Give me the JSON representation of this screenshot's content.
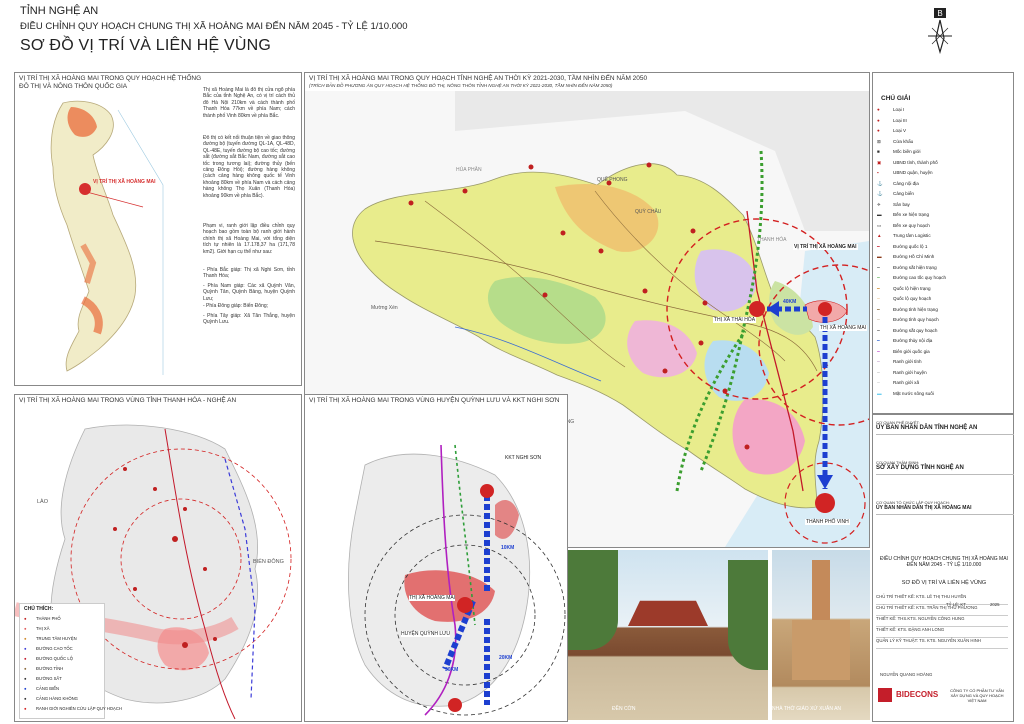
{
  "header": {
    "province": "TỈNH NGHỆ AN",
    "project": "ĐIỀU CHỈNH QUY HOẠCH CHUNG THỊ XÃ HOÀNG MAI ĐẾN NĂM 2045 - TỶ LỆ 1/10.000",
    "sheet_title": "SƠ ĐỒ VỊ TRÍ VÀ LIÊN HỆ VÙNG"
  },
  "panel_national": {
    "title1": "VỊ TRÍ THỊ XÃ HOÀNG MAI TRONG QUY HOẠCH HỆ THỐNG",
    "title2": "ĐÔ THỊ VÀ NÔNG THÔN QUỐC GIA",
    "map_label": "VỊ TRÍ THỊ XÃ HOÀNG MAI",
    "text1": "Thị xã Hoàng Mai là đô thị cửa ngõ phía Bắc của tỉnh Nghệ An, có vị trí cách thủ đô Hà Nội 210km và cách thành phố Thanh Hóa 77km về phía Nam; cách thành phố Vinh 80km về phía Bắc.",
    "text2": "Đô thị có kết nối thuận tiện về giao thông đường bộ (tuyến đường QL-1A, QL-48D, QL-48E, tuyến đường bộ cao tốc; đường sắt (đường sắt Bắc Nam, đường sắt cao tốc trong tương lai); đường thủy (bến cảng Đông Hồi); đường hàng không (cách cảng hàng không quốc tế Vinh khoảng 80km về phía Nam và cách cảng hàng không Thọ Xuân (Thanh Hóa) khoảng 90km về phía Bắc).",
    "text3": "Phạm vi, ranh giới lập điều chỉnh quy hoạch bao gồm toàn bộ ranh giới hành chính thị xã Hoàng Mai, với tổng diện tích tự nhiên là 17.178,37 ha (171,78 km2). Giới hạn cụ thể như sau:",
    "bounds": [
      "- Phía Bắc giáp: Thị xã Nghi Sơn, tỉnh Thanh Hóa;",
      "- Phía Nam giáp: Các xã Quỳnh Văn, Quỳnh Tân, Quỳnh Bảng, huyện Quỳnh Lưu;",
      "- Phía Đông giáp: Biển Đông;",
      "- Phía Tây giáp: Xã Tân Thắng, huyện Quỳnh Lưu."
    ]
  },
  "panel_province": {
    "title1": "VỊ TRÍ THỊ XÃ HOÀNG MAI TRONG QUY HOẠCH TỈNH NGHỆ AN THỜI KỲ 2021-2030, TẦM NHÌN ĐẾN NĂM 2050",
    "title2": "(TRÍCH BẢN ĐỒ PHƯƠNG ÁN QUY HOẠCH HỆ THỐNG ĐÔ THỊ, NÔNG THÔN TỈNH NGHỆ AN THỜI KỲ 2021-2030, TẦM NHÌN ĐẾN NĂM 2050)",
    "labels": {
      "hua_phan": "HỦA PHĂN",
      "thanh_hoa": "THANH HÓA",
      "que_phong": "QUẾ PHONG",
      "quy_chau": "QUỲ CHÂU",
      "con_cuong": "CON CUÔNG",
      "muong_xen": "Mường Xén",
      "tx_thai_hoa": "THỊ XÃ THÁI HÒA",
      "tx_hoang_mai": "THỊ XÃ HOÀNG MAI",
      "tp_vinh": "THÀNH PHỐ VINH",
      "vitri": "VỊ TRÍ THỊ XÃ HOÀNG MAI",
      "dist": "40KM"
    }
  },
  "legend": {
    "title": "CHÚ GIẢI",
    "items": [
      "Loại I",
      "Loại III",
      "Loại V",
      "Cửa khẩu",
      "Mốc biên giới",
      "UBND tỉnh, thành phố",
      "UBND quận, huyện",
      "Cảng nội địa",
      "Cảng biển",
      "Sân bay",
      "Bến xe hiện trạng",
      "Bến xe quy hoạch",
      "Trung tâm Logistic",
      "Đường quốc lộ 1",
      "Đường Hồ Chí Minh",
      "Đường sắt hiện trạng",
      "Đường cao tốc quy hoạch",
      "Quốc lộ hiện trạng",
      "Quốc lộ quy hoạch",
      "Đường tỉnh hiện trạng",
      "Đường tỉnh quy hoạch",
      "Đường sắt quy hoạch",
      "Đường thủy nội địa",
      "Biên giới quốc gia",
      "Ranh giới tỉnh",
      "Ranh giới huyện",
      "Ranh giới xã",
      "Mặt nước sông suối"
    ]
  },
  "panel_region": {
    "title": "VỊ TRÍ THỊ XÃ HOÀNG MAI TRONG VÙNG TỈNH THANH HÓA - NGHỆ AN",
    "lao": "LÀO",
    "bien_dong": "BIỂN ĐÔNG",
    "legend_title": "CHÚ THÍCH:",
    "legend_items": [
      "THÀNH PHỐ",
      "THỊ XÃ",
      "TRUNG TÂM HUYỆN",
      "ĐƯỜNG CAO TỐC",
      "ĐƯỜNG QUỐC LỘ",
      "ĐƯỜNG TỈNH",
      "ĐƯỜNG SẮT",
      "CẢNG BIỂN",
      "CẢNG HÀNG KHÔNG",
      "RANH GIỚI NGHIÊN CỨU LẬP QUY HOẠCH"
    ]
  },
  "panel_district": {
    "title": "VỊ TRÍ THỊ XÃ HOÀNG MAI TRONG VÙNG HUYỆN QUỲNH LƯU VÀ KKT NGHI SƠN",
    "labels": [
      "THỊ XÃ HOÀNG MAI",
      "HUYỆN QUỲNH LƯU",
      "KKT NGHI SƠN",
      "10KM",
      "20KM",
      "30KM"
    ]
  },
  "photos": {
    "left_caption": "ĐỀN CỜN",
    "right_caption": "NHÀ THỜ GIÁO XỨ XUÂN AN"
  },
  "title_block": {
    "rows": [
      {
        "label": "CƠ QUAN PHÊ DUYỆT:",
        "value": "ỦY BAN NHÂN DÂN TỈNH NGHỆ AN"
      },
      {
        "label": "CƠ QUAN THẨM ĐỊNH:",
        "value": "SỞ XÂY DỰNG TỈNH NGHỆ AN"
      },
      {
        "label": "CƠ QUAN TỔ CHỨC LẬP QUY HOẠCH:",
        "value": "ỦY BAN NHÂN DÂN THỊ XÃ HOÀNG MAI"
      }
    ],
    "project_short": "ĐIỀU CHỈNH QUY HOẠCH CHUNG THỊ XÃ HOÀNG MAI ĐẾN NĂM 2045 - TỶ LỆ 1/10.000",
    "sheet": "SƠ ĐỒ VỊ TRÍ VÀ LIÊN HỆ VÙNG",
    "staff": [
      {
        "role": "CHỦ TRÌ THIẾT KẾ:",
        "name": "KTS. LÊ THỊ THU HUYỀN"
      },
      {
        "role": "CHỦ TRÌ THIẾT KẾ:",
        "name": "KTS. TRẦN THỊ THU PHƯƠNG"
      },
      {
        "role": "THIẾT KẾ:",
        "name": "THS.KTS. NGUYỄN CÔNG HUNG"
      },
      {
        "role": "THIẾT KẾ:",
        "name": "KTS. ĐẶNG ANH LONG"
      },
      {
        "role": "QUẢN LÝ KỸ THUẬT:",
        "name": "TS. KTS. NGUYỄN XUÂN HINH"
      }
    ],
    "scale_no": "TỶ LỆ: KT",
    "year": "2025",
    "director": "NGUYỄN QUANG HOÀNG",
    "company_logo": "BIDECONS",
    "company": "CÔNG TY CỔ PHẦN TƯ VẤN XÂY DỰNG VÀ QUY HOẠCH VIỆT NAM"
  },
  "colors": {
    "border": "#8a8a8a",
    "dashed_circle": "#d32020",
    "arrow_blue": "#1d3fd0",
    "hm_red": "#e03c3c",
    "yellow": "#e8ec8c",
    "green": "#b6dd8a",
    "pink": "#efb7d6",
    "sea": "#d8ecf6"
  }
}
